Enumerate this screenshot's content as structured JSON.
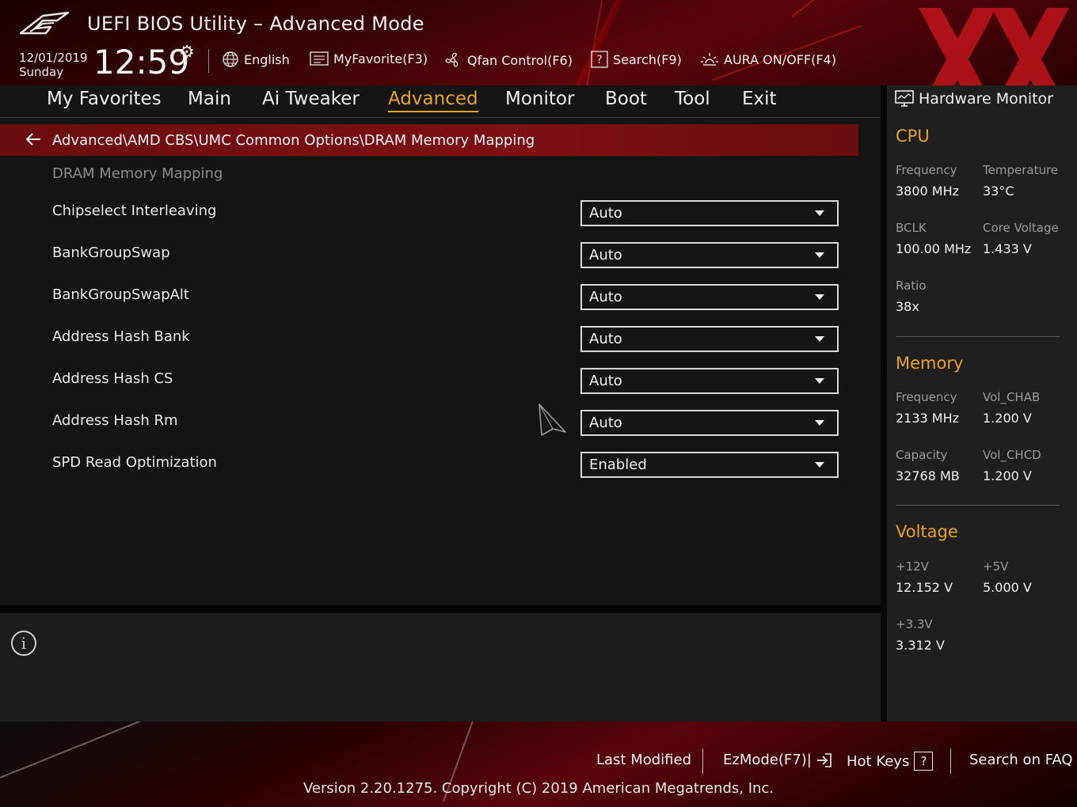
{
  "header": {
    "title": "UEFI BIOS Utility – Advanced Mode",
    "date": "12/01/2019",
    "day": "Sunday",
    "time": "12:59",
    "language": "English",
    "myfavorite": "MyFavorite(F3)",
    "qfan": "Qfan Control(F6)",
    "search": "Search(F9)",
    "aura": "AURA ON/OFF(F4)"
  },
  "nav": {
    "tabs": [
      {
        "label": "My Favorites"
      },
      {
        "label": "Main"
      },
      {
        "label": "Ai Tweaker"
      },
      {
        "label": "Advanced"
      },
      {
        "label": "Monitor"
      },
      {
        "label": "Boot"
      },
      {
        "label": "Tool"
      },
      {
        "label": "Exit"
      }
    ],
    "active": "Advanced"
  },
  "breadcrumb": {
    "path": "Advanced\\AMD CBS\\UMC Common Options\\DRAM Memory Mapping"
  },
  "main": {
    "section_title": "DRAM Memory Mapping",
    "settings": [
      {
        "label": "Chipselect Interleaving",
        "value": "Auto"
      },
      {
        "label": "BankGroupSwap",
        "value": "Auto"
      },
      {
        "label": "BankGroupSwapAlt",
        "value": "Auto"
      },
      {
        "label": "Address Hash Bank",
        "value": "Auto"
      },
      {
        "label": "Address Hash CS",
        "value": "Auto"
      },
      {
        "label": "Address Hash Rm",
        "value": "Auto"
      },
      {
        "label": "SPD Read Optimization",
        "value": "Enabled"
      }
    ]
  },
  "hw": {
    "title": "Hardware Monitor",
    "cpu": {
      "heading": "CPU",
      "freq_label": "Frequency",
      "freq": "3800 MHz",
      "temp_label": "Temperature",
      "temp": "33°C",
      "bclk_label": "BCLK",
      "bclk": "100.00 MHz",
      "vcore_label": "Core Voltage",
      "vcore": "1.433 V",
      "ratio_label": "Ratio",
      "ratio": "38x"
    },
    "memory": {
      "heading": "Memory",
      "freq_label": "Frequency",
      "freq": "2133 MHz",
      "chab_label": "Vol_CHAB",
      "chab": "1.200 V",
      "cap_label": "Capacity",
      "cap": "32768 MB",
      "chcd_label": "Vol_CHCD",
      "chcd": "1.200 V"
    },
    "voltage": {
      "heading": "Voltage",
      "v12_label": "+12V",
      "v12": "12.152 V",
      "v5_label": "+5V",
      "v5": "5.000 V",
      "v33_label": "+3.3V",
      "v33": "3.312 V"
    }
  },
  "footer": {
    "last_modified": "Last Modified",
    "ezmode": "EzMode(F7)|",
    "hotkeys": "Hot Keys",
    "hotkeys_key": "?",
    "faq": "Search on FAQ",
    "version": "Version 2.20.1275. Copyright (C) 2019 American Megatrends, Inc."
  },
  "colors": {
    "accent": "#e7a51c",
    "breadcrumb_bg": "#7c1014",
    "panel_bg": "#1f1f1f"
  },
  "icons": [
    "rog-logo-icon",
    "gear-icon",
    "globe-icon",
    "favorite-list-icon",
    "fan-icon",
    "search-help-icon",
    "aura-light-icon",
    "back-arrow-icon",
    "chevron-down-icon",
    "info-icon",
    "monitor-icon",
    "exit-arrow-icon",
    "mouse-cursor-icon"
  ]
}
